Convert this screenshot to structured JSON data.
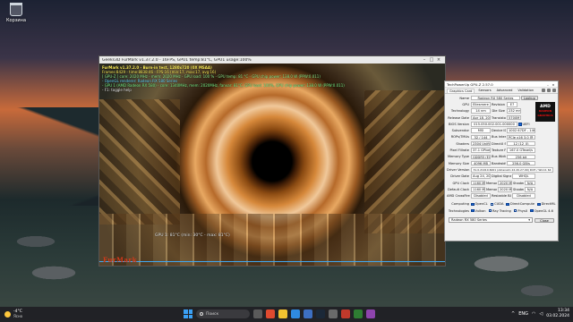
{
  "desktop": {
    "recycle_bin_label": "Корзина"
  },
  "furmark": {
    "title": "Geeks3D FurMark v1.37.2.0 - 16FPS, GPU1 temp:81°C, GPU1 usage:100%",
    "overlay_lines": [
      "FurMark v1.37.2.0 - Burn-in test, 1280x720 (0X MSAA)",
      "Frames:8429 - time:8838:46 - FPS:16 (min:17, max:17, avg:16)",
      "[ GPU-Z ] core: 2020 MHz - mem: 2020 MHz - GPU load: 100 % - GPU temp: 81 °C - GPU chip power: 138.0 W (PPW:0.011)",
      "- OpenGL renderer: Radeon RX 580 Series",
      "- GPU 1 (AMD Radeon RX 580) - core: 1340MHz, mem: 2020MHz, fanvar: 81°C, GPU load: 100%, GPU chip power: 138.0 W (PPW:0.011)",
      "- F1: toggle help"
    ],
    "temp_label": "GPU 1: 81°C (min: 30°C - max: 81°C)",
    "logo": "FurMark"
  },
  "gpuz": {
    "title": "TechPowerUp GPU-Z 2.57.0",
    "tabs": [
      "Graphics Card",
      "Sensors",
      "Advanced",
      "Validation"
    ],
    "active_tab": 0,
    "logo": "AMD",
    "logo_sub": "RADEON GRAPHICS",
    "rows": [
      {
        "label": "Name",
        "cells": [
          "Radeon RX 580 Series"
        ],
        "button": "Lookup"
      },
      {
        "label": "GPU",
        "cells": [
          "Ellesmere",
          "Revision",
          "E7"
        ]
      },
      {
        "label": "Technology",
        "cells": [
          "14 nm",
          "Die Size",
          "232 mm²"
        ]
      },
      {
        "label": "Release Date",
        "cells": [
          "Apr 18, 2017",
          "Transistors",
          "5700M"
        ]
      },
      {
        "label": "BIOS Version",
        "cells": [
          "015.050.002.001.000000"
        ],
        "button": "UEFI"
      },
      {
        "label": "Subvendor",
        "cells": [
          "MSI",
          "Device ID",
          "1002 67DF - 1462 3417"
        ]
      },
      {
        "label": "ROPs/TMUs",
        "cells": [
          "32 / 144",
          "Bus Interface",
          "PCIe x16 3.0 @ x16 3.0"
        ]
      },
      {
        "label": "Shaders",
        "cells": [
          "2304 Unified",
          "DirectX Support",
          "12 (12_0)"
        ]
      },
      {
        "label": "Pixel Fillrate",
        "cells": [
          "37.1 GPixel/s",
          "Texture Fillrate",
          "167.0 GTexel/s"
        ]
      },
      {
        "label": "Memory Type",
        "cells": [
          "GDDR5 (Elpida)",
          "Bus Width",
          "256 bit"
        ]
      },
      {
        "label": "Memory Size",
        "cells": [
          "4096 MB",
          "Bandwidth",
          "256.0 GB/s"
        ]
      },
      {
        "label": "Driver Version",
        "cells": [
          "31.0.21010.6001 (Adrenalin 22.20.27.09) DCH / Win11 64"
        ]
      },
      {
        "label": "Driver Date",
        "cells": [
          "Aug 24, 2023",
          "Digital Signature",
          "WHQL"
        ]
      },
      {
        "label": "GPU Clock",
        "cells": [
          "1160 MHz",
          "Memory",
          "2020 MHz",
          "Shader",
          "N/A"
        ]
      },
      {
        "label": "Default Clock",
        "cells": [
          "1160 MHz",
          "Memory",
          "2020 MHz",
          "Shader",
          "N/A"
        ]
      },
      {
        "label": "AMD CrossFire",
        "cells": [
          "Disabled",
          "Resizable BAR",
          "Disabled"
        ]
      }
    ],
    "computing_label": "Computing",
    "computing": [
      "OpenCL",
      "CUDA",
      "DirectCompute",
      "DirectML"
    ],
    "technologies_label": "Technologies",
    "technologies": [
      "Vulkan",
      "Ray Tracing",
      "PhysX",
      "OpenGL 4.6"
    ],
    "selected_gpu": "Radeon RX 580 Series",
    "close_label": "Close"
  },
  "taskbar": {
    "weather_temp": "-4°C",
    "weather_desc": "Ясно",
    "search_placeholder": "Поиск",
    "tray_lang": "ENG",
    "time": "13:34",
    "date": "03.02.2024"
  },
  "colors": {
    "accent": "#3aa0f5",
    "amd_red": "#e11d1d"
  }
}
